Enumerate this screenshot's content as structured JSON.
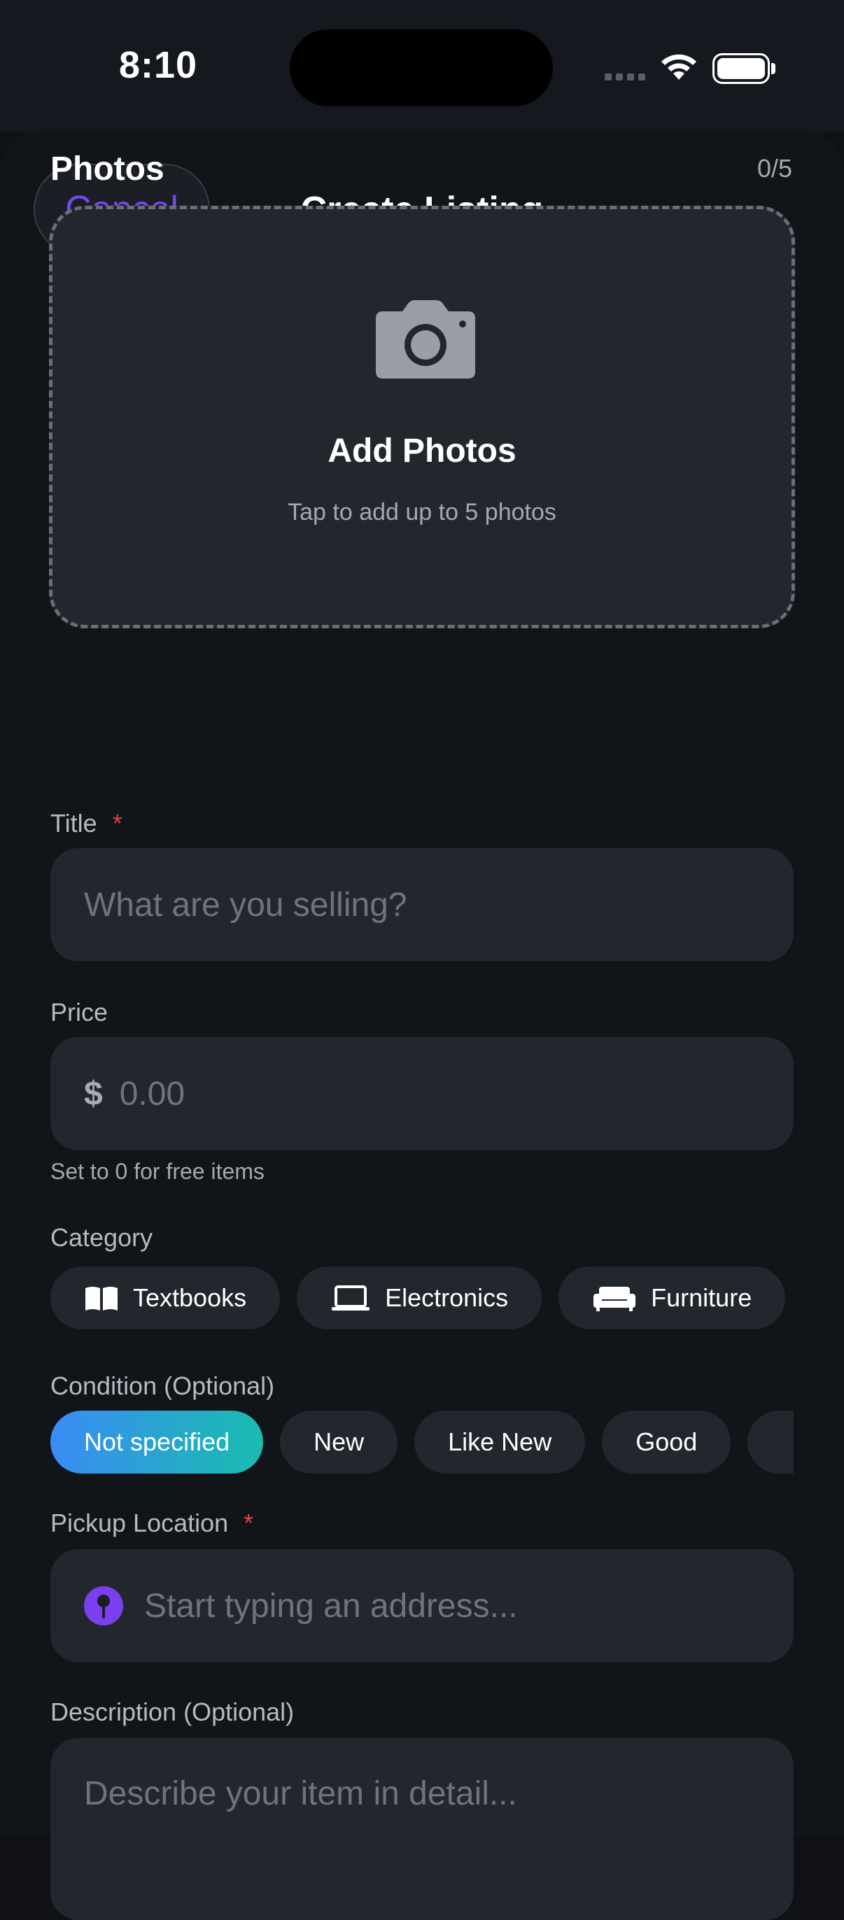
{
  "status_bar": {
    "time": "8:10"
  },
  "header": {
    "cancel_label": "Cancel",
    "title": "Create Listing"
  },
  "photos": {
    "label": "Photos",
    "count": "0/5",
    "add_title": "Add Photos",
    "add_subtitle": "Tap to add up to 5 photos",
    "icon": "camera-icon"
  },
  "title_field": {
    "label": "Title",
    "required_mark": "*",
    "placeholder": "What are you selling?"
  },
  "price_field": {
    "label": "Price",
    "currency_symbol": "$",
    "placeholder": "0.00",
    "hint": "Set to 0 for free items"
  },
  "category": {
    "label": "Category",
    "options": [
      {
        "label": "Textbooks",
        "icon": "book-icon"
      },
      {
        "label": "Electronics",
        "icon": "laptop-icon"
      },
      {
        "label": "Furniture",
        "icon": "sofa-icon"
      }
    ]
  },
  "condition": {
    "label": "Condition (Optional)",
    "options": [
      "Not specified",
      "New",
      "Like New",
      "Good"
    ],
    "selected": "Not specified"
  },
  "pickup_location": {
    "label": "Pickup Location",
    "required_mark": "*",
    "placeholder": "Start typing an address...",
    "icon": "location-pin-icon"
  },
  "description": {
    "label": "Description (Optional)",
    "placeholder": "Describe your item in detail..."
  },
  "colors": {
    "accent": "#7a45f0",
    "required": "#e24545",
    "selected_gradient_start": "#3a8cf4",
    "selected_gradient_end": "#19bcae",
    "background": "#111419",
    "field_background": "#22262d"
  }
}
